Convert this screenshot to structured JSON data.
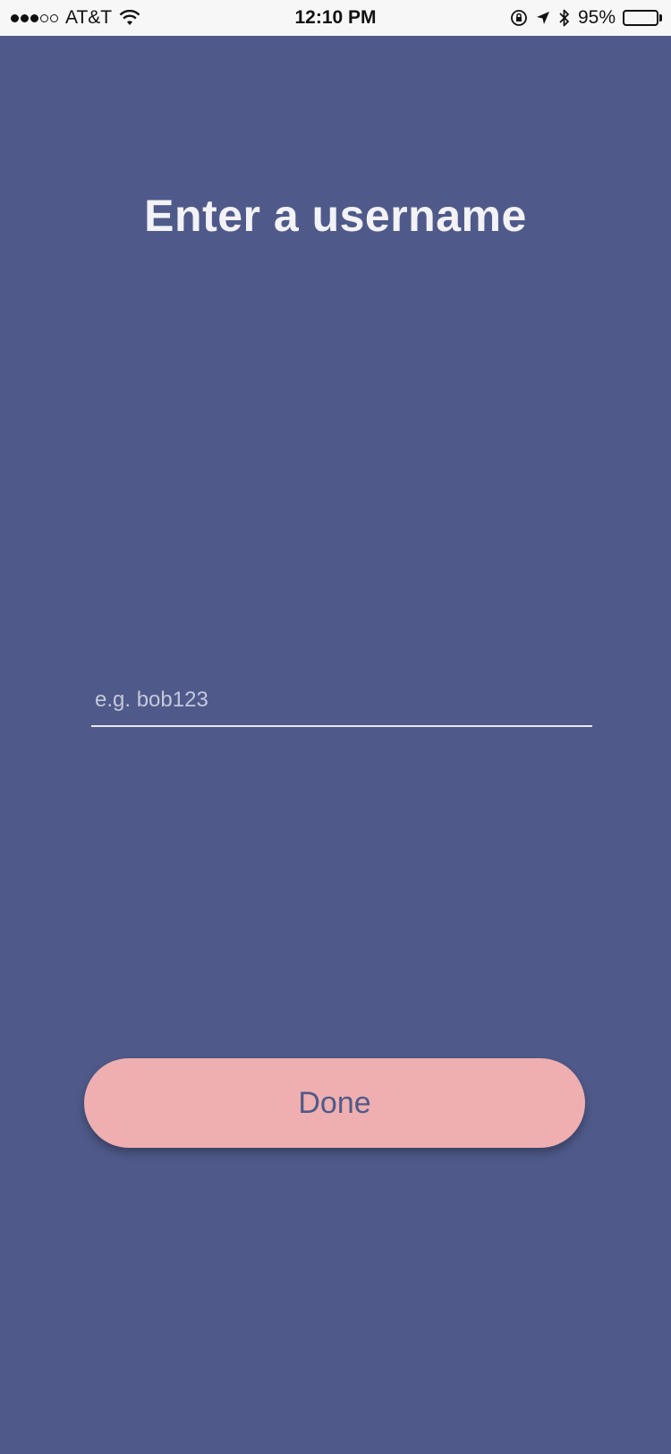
{
  "status_bar": {
    "carrier": "AT&T",
    "time": "12:10 PM",
    "battery_percent": "95%",
    "battery_level": 0.95,
    "signal_bars_filled": 3,
    "signal_bars_total": 5,
    "icons": [
      "wifi-icon",
      "lock-rotation-icon",
      "location-arrow-icon",
      "bluetooth-icon",
      "battery-icon"
    ]
  },
  "screen": {
    "title": "Enter a username",
    "background_color": "#4f5a8a"
  },
  "username_input": {
    "placeholder": "e.g. bob123",
    "value": ""
  },
  "done_button": {
    "label": "Done",
    "color": "#efafb0"
  }
}
